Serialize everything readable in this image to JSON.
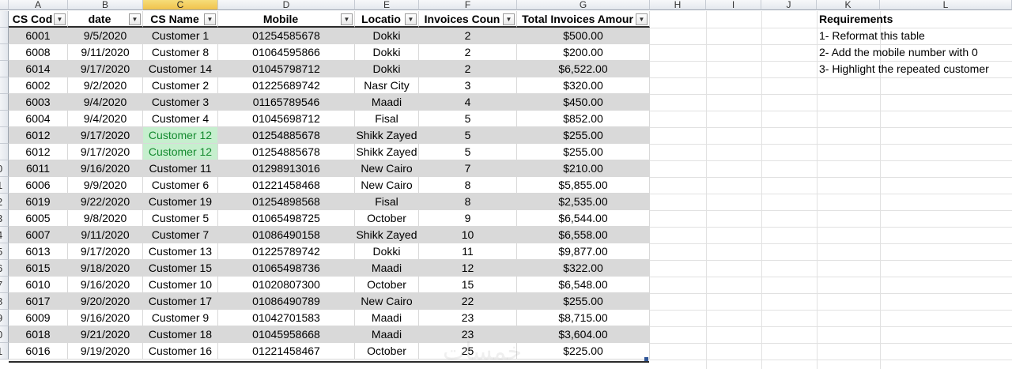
{
  "columns": [
    "A",
    "B",
    "C",
    "D",
    "E",
    "F",
    "G",
    "H",
    "I",
    "J",
    "K",
    "L"
  ],
  "selected_column": "C",
  "row_numbers": [
    "",
    "",
    "",
    "",
    "",
    "",
    "",
    "",
    "",
    "0",
    "1",
    "2",
    "3",
    "4",
    "5",
    "6",
    "7",
    "8",
    "9",
    "0",
    "1"
  ],
  "table": {
    "headers": [
      "CS Cod",
      "date",
      "CS Name",
      "Mobile",
      "Locatio",
      "Invoices Coun",
      "Total Invoices Amour"
    ],
    "rows": [
      [
        "6001",
        "9/5/2020",
        "Customer 1",
        "01254585678",
        "Dokki",
        "2",
        "$500.00"
      ],
      [
        "6008",
        "9/11/2020",
        "Customer 8",
        "01064595866",
        "Dokki",
        "2",
        "$200.00"
      ],
      [
        "6014",
        "9/17/2020",
        "Customer 14",
        "01045798712",
        "Dokki",
        "2",
        "$6,522.00"
      ],
      [
        "6002",
        "9/2/2020",
        "Customer 2",
        "01225689742",
        "Nasr City",
        "3",
        "$320.00"
      ],
      [
        "6003",
        "9/4/2020",
        "Customer 3",
        "01165789546",
        "Maadi",
        "4",
        "$450.00"
      ],
      [
        "6004",
        "9/4/2020",
        "Customer 4",
        "01045698712",
        "Fisal",
        "5",
        "$852.00"
      ],
      [
        "6012",
        "9/17/2020",
        "Customer 12",
        "01254885678",
        "Shikk Zayed",
        "5",
        "$255.00"
      ],
      [
        "6012",
        "9/17/2020",
        "Customer 12",
        "01254885678",
        "Shikk Zayed",
        "5",
        "$255.00"
      ],
      [
        "6011",
        "9/16/2020",
        "Customer 11",
        "01298913016",
        "New Cairo",
        "7",
        "$210.00"
      ],
      [
        "6006",
        "9/9/2020",
        "Customer 6",
        "01221458468",
        "New Cairo",
        "8",
        "$5,855.00"
      ],
      [
        "6019",
        "9/22/2020",
        "Customer 19",
        "01254898568",
        "Fisal",
        "8",
        "$2,535.00"
      ],
      [
        "6005",
        "9/8/2020",
        "Customer 5",
        "01065498725",
        "October",
        "9",
        "$6,544.00"
      ],
      [
        "6007",
        "9/11/2020",
        "Customer 7",
        "01086490158",
        "Shikk Zayed",
        "10",
        "$6,558.00"
      ],
      [
        "6013",
        "9/17/2020",
        "Customer 13",
        "01225789742",
        "Dokki",
        "11",
        "$9,877.00"
      ],
      [
        "6015",
        "9/18/2020",
        "Customer 15",
        "01065498736",
        "Maadi",
        "12",
        "$322.00"
      ],
      [
        "6010",
        "9/16/2020",
        "Customer 10",
        "01020807300",
        "October",
        "15",
        "$6,548.00"
      ],
      [
        "6017",
        "9/20/2020",
        "Customer 17",
        "01086490789",
        "New Cairo",
        "22",
        "$255.00"
      ],
      [
        "6009",
        "9/16/2020",
        "Customer 9",
        "01042701583",
        "Maadi",
        "23",
        "$8,715.00"
      ],
      [
        "6018",
        "9/21/2020",
        "Customer 18",
        "01045958668",
        "Maadi",
        "23",
        "$3,604.00"
      ],
      [
        "6016",
        "9/19/2020",
        "Customer 16",
        "01221458467",
        "October",
        "25",
        "$225.00"
      ]
    ],
    "highlight_rows": [
      6,
      7
    ]
  },
  "requirements": {
    "title": "Requirements",
    "items": [
      "1- Reformat this table",
      "2- Add the mobile number with 0",
      "3- Highlight the repeated customer"
    ]
  },
  "watermark": "خمسات",
  "colors": {
    "band": "#d9d9d9",
    "duplicate_fill": "#c6efce",
    "duplicate_text": "#148a2f",
    "selected_header": "#f0c24c"
  }
}
